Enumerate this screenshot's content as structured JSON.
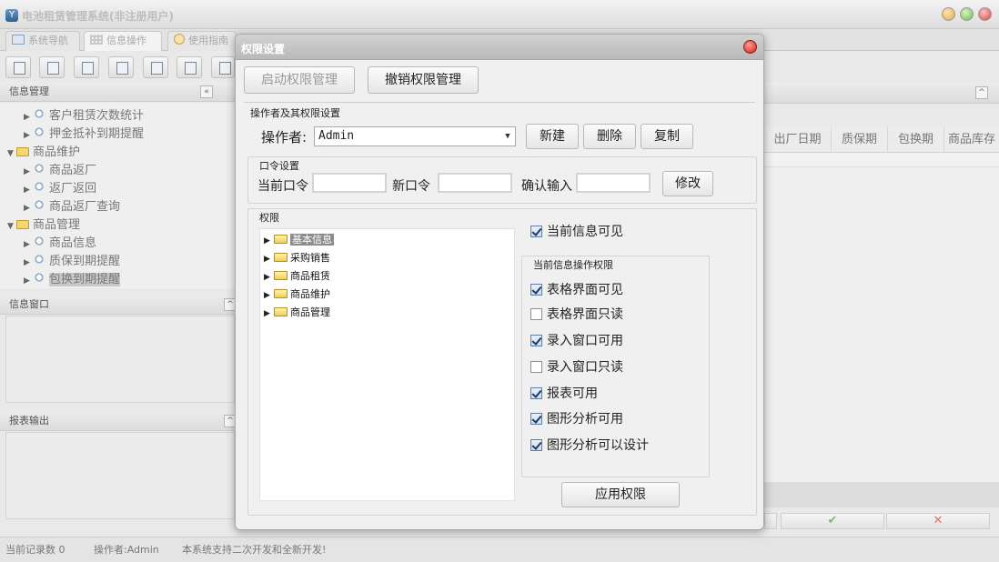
{
  "app": {
    "title": "电池租赁管理系统(非注册用户)",
    "icon_letter": "Y"
  },
  "tabs": [
    {
      "label": "系统导航"
    },
    {
      "label": "信息操作"
    },
    {
      "label": "使用指南"
    }
  ],
  "left_panel": {
    "info_mgmt_title": "信息管理",
    "tree": [
      {
        "label": "客户租赁次数统计",
        "kind": "leaf"
      },
      {
        "label": "押金抵补到期提醒",
        "kind": "leaf"
      },
      {
        "label": "商品维护",
        "kind": "folder"
      },
      {
        "label": "商品返厂",
        "kind": "leaf"
      },
      {
        "label": "返厂返回",
        "kind": "leaf"
      },
      {
        "label": "商品返厂查询",
        "kind": "leaf"
      },
      {
        "label": "商品管理",
        "kind": "folder"
      },
      {
        "label": "商品信息",
        "kind": "leaf"
      },
      {
        "label": "质保到期提醒",
        "kind": "leaf"
      },
      {
        "label": "包换到期提醒",
        "kind": "leaf"
      }
    ],
    "info_window_title": "信息窗口",
    "report_title": "报表输出"
  },
  "grid": {
    "columns": [
      "出厂日期",
      "质保期",
      "包换期",
      "商品库存"
    ]
  },
  "status_bar": {
    "record_count": "当前记录数 0",
    "operator": "操作者:Admin",
    "message": "本系统支持二次开发和全新开发!"
  },
  "dialog": {
    "title": "权限设置",
    "enable_btn": "启动权限管理",
    "revoke_btn": "撤销权限管理",
    "operator_section": "操作者及其权限设置",
    "operator_label": "操作者:",
    "operator_value": "Admin",
    "new_btn": "新建",
    "delete_btn": "删除",
    "copy_btn": "复制",
    "password_section": "口令设置",
    "current_pw_label": "当前口令",
    "new_pw_label": "新口令",
    "confirm_pw_label": "确认输入",
    "modify_btn": "修改",
    "permission_section": "权限",
    "perm_tree": [
      {
        "label": "基本信息",
        "selected": true
      },
      {
        "label": "采购销售",
        "selected": false
      },
      {
        "label": "商品租赁",
        "selected": false
      },
      {
        "label": "商品维护",
        "selected": false
      },
      {
        "label": "商品管理",
        "selected": false
      }
    ],
    "current_visible": {
      "label": "当前信息可见",
      "checked": true
    },
    "ops_section": "当前信息操作权限",
    "ops": [
      {
        "label": "表格界面可见",
        "checked": true
      },
      {
        "label": "表格界面只读",
        "checked": false
      },
      {
        "label": "录入窗口可用",
        "checked": true
      },
      {
        "label": "录入窗口只读",
        "checked": false
      },
      {
        "label": "报表可用",
        "checked": true
      },
      {
        "label": "图形分析可用",
        "checked": true
      },
      {
        "label": "图形分析可以设计",
        "checked": true
      }
    ],
    "apply_btn": "应用权限"
  }
}
